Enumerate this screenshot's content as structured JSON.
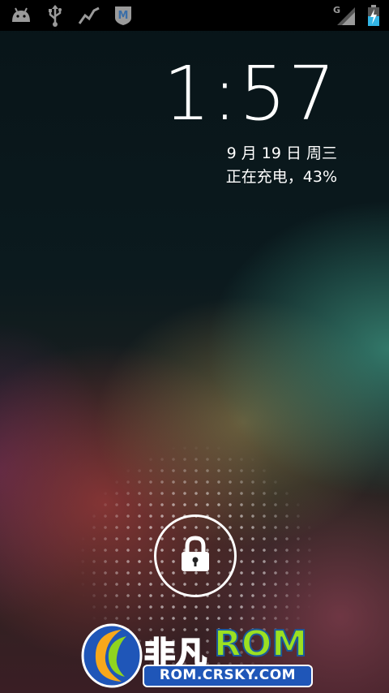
{
  "status_bar": {
    "notification_icons": [
      "android-debug-icon",
      "usb-icon",
      "activity-graph-icon",
      "m-badge-app-icon"
    ],
    "network_type": "G",
    "status_icons": [
      "signal-strength-icon",
      "battery-charging-icon"
    ]
  },
  "lockscreen": {
    "time": "1:57",
    "date": "9 月 19 日 周三",
    "charging_status": "正在充电，43%",
    "unlock_icon": "lock-icon"
  },
  "watermark": {
    "brand_cn": "非凡",
    "brand_en": "ROM",
    "url": "ROM.CRSKY.COM"
  },
  "colors": {
    "status_bar_bg": "#000000",
    "logo_blue": "#1f56b8",
    "logo_green": "#9be022"
  }
}
